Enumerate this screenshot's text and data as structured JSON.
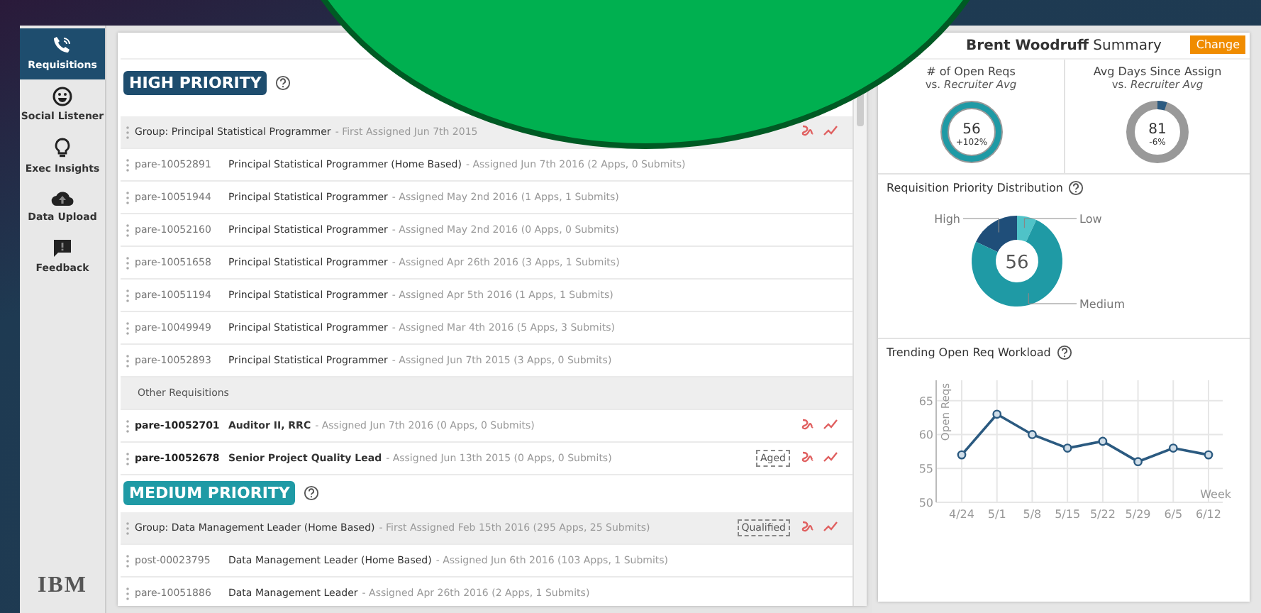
{
  "sidebar": {
    "items": [
      {
        "label": "Requisitions",
        "selected": true
      },
      {
        "label": "Social Listener",
        "selected": false
      },
      {
        "label": "Exec Insights",
        "selected": false
      },
      {
        "label": "Data Upload",
        "selected": false
      },
      {
        "label": "Feedback",
        "selected": false
      }
    ],
    "logo": "IBM"
  },
  "sections": [
    {
      "title": "HIGH PRIORITY",
      "color": "#1e4d6e",
      "rows": [
        {
          "kind": "group",
          "title": "Group: Principal Statistical Programmer",
          "meta": "- First Assigned Jun 7th 2015",
          "actions": true
        },
        {
          "kind": "item",
          "id": "pare-10052891",
          "title": "Principal Statistical Programmer (Home Based)",
          "meta": "- Assigned Jun 7th 2016 (2 Apps, 0 Submits)",
          "bold": false,
          "actions": false
        },
        {
          "kind": "item",
          "id": "pare-10051944",
          "title": "Principal Statistical Programmer",
          "meta": "- Assigned May 2nd 2016 (1 Apps, 1 Submits)",
          "bold": false,
          "actions": false
        },
        {
          "kind": "item",
          "id": "pare-10052160",
          "title": "Principal Statistical Programmer",
          "meta": "- Assigned May 2nd 2016 (0 Apps, 0 Submits)",
          "bold": false,
          "actions": false
        },
        {
          "kind": "item",
          "id": "pare-10051658",
          "title": "Principal Statistical Programmer",
          "meta": "- Assigned Apr 26th 2016 (3 Apps, 1 Submits)",
          "bold": false,
          "actions": false
        },
        {
          "kind": "item",
          "id": "pare-10051194",
          "title": "Principal Statistical Programmer",
          "meta": "- Assigned Apr 5th 2016 (1 Apps, 1 Submits)",
          "bold": false,
          "actions": false
        },
        {
          "kind": "item",
          "id": "pare-10049949",
          "title": "Principal Statistical Programmer",
          "meta": "- Assigned Mar 4th 2016 (5 Apps, 3 Submits)",
          "bold": false,
          "actions": false
        },
        {
          "kind": "item",
          "id": "pare-10052893",
          "title": "Principal Statistical Programmer",
          "meta": "- Assigned Jun 7th 2015 (3 Apps, 0 Submits)",
          "bold": false,
          "actions": false
        },
        {
          "kind": "section",
          "title": "Other Requisitions"
        },
        {
          "kind": "item",
          "id": "pare-10052701",
          "title": "Auditor II, RRC",
          "meta": "- Assigned Jun 7th 2016 (0 Apps, 0 Submits)",
          "bold": true,
          "actions": true
        },
        {
          "kind": "item",
          "id": "pare-10052678",
          "title": "Senior Project Quality Lead",
          "meta": "- Assigned Jun 13th 2015 (0 Apps, 0 Submits)",
          "bold": true,
          "actions": true,
          "badge": "Aged"
        }
      ]
    },
    {
      "title": "MEDIUM PRIORITY",
      "color": "#1f9aa5",
      "rows": [
        {
          "kind": "group",
          "title": "Group: Data Management Leader (Home Based)",
          "meta": "- First Assigned Feb 15th 2016 (295 Apps, 25 Submits)",
          "actions": true,
          "badge": "Qualified"
        },
        {
          "kind": "item",
          "id": "post-00023795",
          "title": "Data Management Leader (Home Based)",
          "meta": "- Assigned Jun 6th 2016 (103 Apps, 1 Submits)",
          "bold": false,
          "actions": false
        },
        {
          "kind": "item",
          "id": "pare-10051886",
          "title": "Data Management Leader",
          "meta": "- Assigned Apr 26th 2016 (2 Apps, 1 Submits)",
          "bold": false,
          "actions": false
        }
      ]
    }
  ],
  "summary": {
    "title": "**Brent Woodruff** Summary",
    "change": "Change",
    "gauges": [
      {
        "title": "# of Open Reqs",
        "subtitle": "vs. *Recruiter Avg*",
        "value": "56",
        "delta": "+102%",
        "level": 1
      },
      {
        "title": "Avg Days Since Assign",
        "subtitle": "vs. *Recruiter Avg*",
        "value": "81",
        "delta": "-6%",
        "level": 0.05
      }
    ],
    "distribution": {
      "title": "Requisition Priority Distribution",
      "total": "56",
      "segments": [
        {
          "label": "High",
          "color": "#1f4e79"
        },
        {
          "label": "Low",
          "color": "#4fc3c8"
        },
        {
          "label": "Medium",
          "color": "#1f9aa5"
        }
      ]
    },
    "trend": {
      "title": "Trending Open Req Workload",
      "chart_data": {
        "type": "line",
        "xlabel": "Week",
        "ylabel": "Open Reqs",
        "grid": true,
        "categories": [
          "4/24",
          "5/1",
          "5/8",
          "5/15",
          "5/22",
          "5/29",
          "6/5",
          "6/12"
        ],
        "series": [
          {
            "color": "#2b5a80",
            "marker": true,
            "values": [
              57,
              63,
              60,
              58,
              59,
              56,
              58,
              57
            ]
          }
        ],
        "ylim": [
          50,
          68
        ],
        "yticks": [
          50,
          55,
          60,
          65
        ]
      }
    }
  }
}
